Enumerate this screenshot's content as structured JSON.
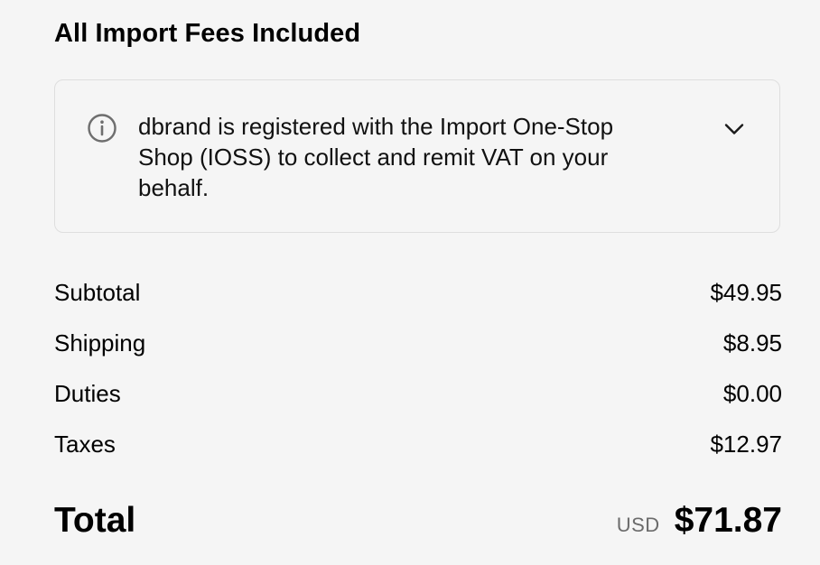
{
  "header": {
    "title": "All Import Fees Included"
  },
  "notice": {
    "icon": "info-circle-icon",
    "text": "dbrand is registered with the Import One-Stop Shop (IOSS) to collect and remit VAT on your behalf.",
    "toggle_icon": "chevron-down-icon"
  },
  "summary": {
    "rows": [
      {
        "label": "Subtotal",
        "value": "$49.95"
      },
      {
        "label": "Shipping",
        "value": "$8.95"
      },
      {
        "label": "Duties",
        "value": "$0.00"
      },
      {
        "label": "Taxes",
        "value": "$12.97"
      }
    ],
    "total_label": "Total",
    "currency": "USD",
    "total_value": "$71.87"
  },
  "colors": {
    "background": "#f5f5f5",
    "border": "#dedede",
    "muted_text": "#6b6b6b",
    "icon_gray": "#6e6e6e"
  }
}
